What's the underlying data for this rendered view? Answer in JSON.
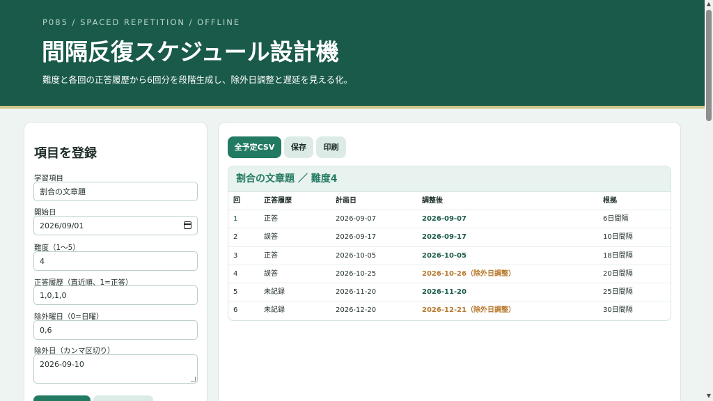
{
  "header": {
    "eyebrow": "P085 / SPACED REPETITION / OFFLINE",
    "title": "間隔反復スケジュール設計機",
    "subtitle": "難度と各回の正答履歴から6回分を段階生成し、除外日調整と遅延を見える化。"
  },
  "form": {
    "title": "項目を登録",
    "fields": {
      "item": {
        "label": "学習項目",
        "value": "割合の文章題"
      },
      "start": {
        "label": "開始日",
        "value": "2026/09/01"
      },
      "difficulty": {
        "label": "難度（1〜5）",
        "value": "4"
      },
      "history": {
        "label": "正答履歴（直近順、1=正答）",
        "value": "1,0,1,0"
      },
      "weekdays": {
        "label": "除外曜日（0=日曜）",
        "value": "0,6"
      },
      "exclude": {
        "label": "除外日（カンマ区切り）",
        "value": "2026-09-10"
      }
    }
  },
  "toolbar": {
    "csv": "全予定CSV",
    "save": "保存",
    "print": "印刷"
  },
  "schedule": {
    "title": "割合の文章題 ／ 難度4",
    "columns": {
      "no": "回",
      "result": "正答履歴",
      "plan": "計画日",
      "adjusted": "調整後",
      "basis": "根拠"
    },
    "rows": [
      {
        "no": "1",
        "result": "正答",
        "plan": "2026-09-07",
        "adjusted": "2026-09-07",
        "basis": "6日間隔",
        "shifted": false
      },
      {
        "no": "2",
        "result": "誤答",
        "plan": "2026-09-17",
        "adjusted": "2026-09-17",
        "basis": "10日間隔",
        "shifted": false
      },
      {
        "no": "3",
        "result": "正答",
        "plan": "2026-10-05",
        "adjusted": "2026-10-05",
        "basis": "18日間隔",
        "shifted": false
      },
      {
        "no": "4",
        "result": "誤答",
        "plan": "2026-10-25",
        "adjusted": "2026-10-26（除外日調整）",
        "basis": "20日間隔",
        "shifted": true
      },
      {
        "no": "5",
        "result": "未記録",
        "plan": "2026-11-20",
        "adjusted": "2026-11-20",
        "basis": "25日間隔",
        "shifted": false
      },
      {
        "no": "6",
        "result": "未記録",
        "plan": "2026-12-20",
        "adjusted": "2026-12-21（除外日調整）",
        "basis": "30日間隔",
        "shifted": true
      }
    ]
  },
  "colors": {
    "brand": "#1a5a4a",
    "accent": "#237a62",
    "shifted": "#b7792d",
    "header_rule": "#cfc58a"
  }
}
